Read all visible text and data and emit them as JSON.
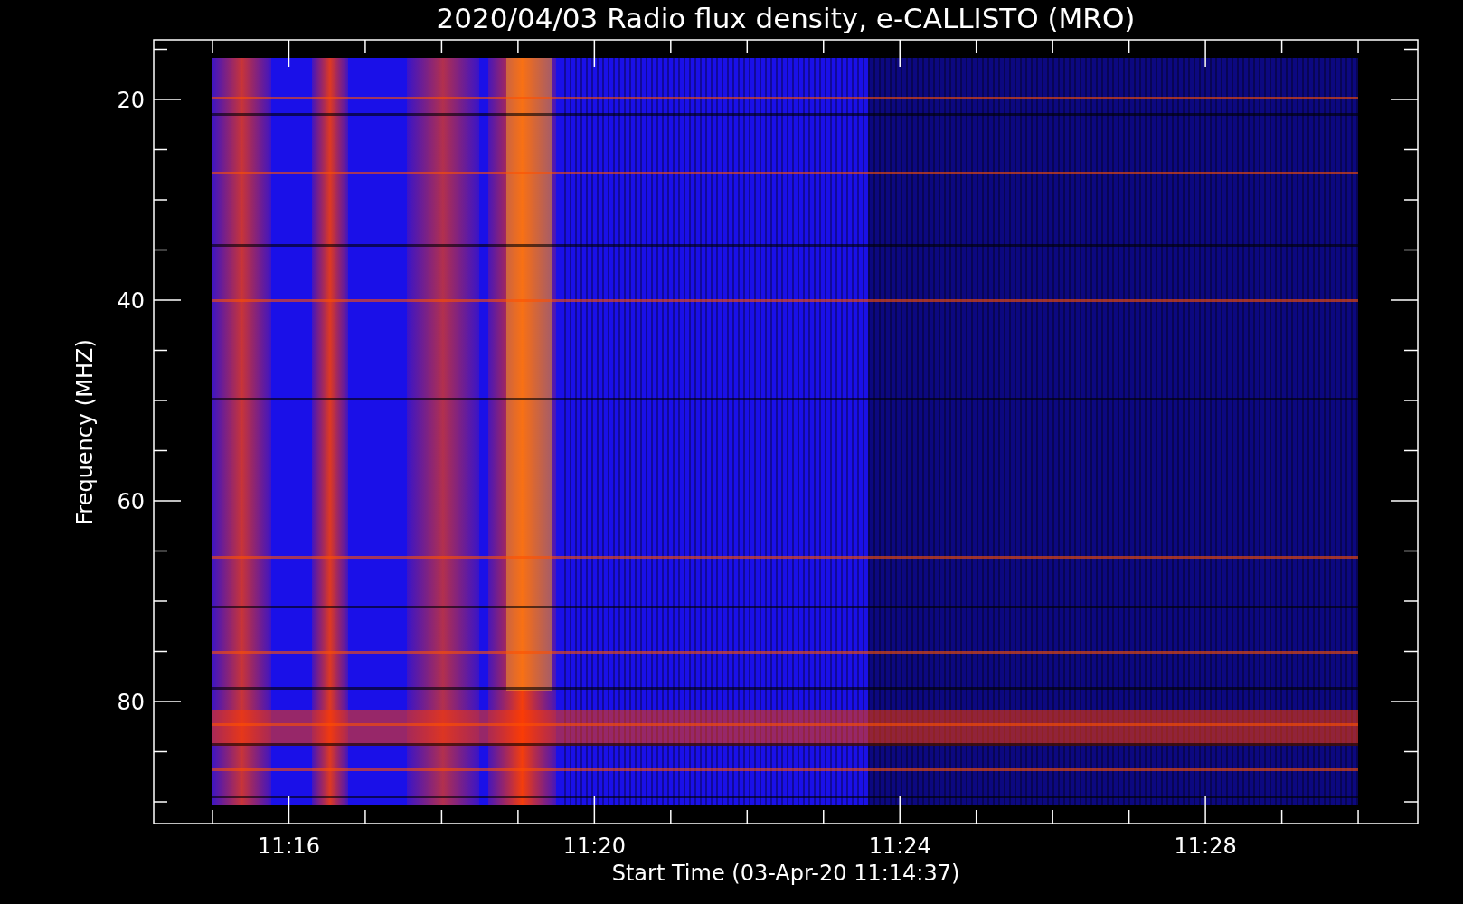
{
  "title": "2020/04/03  Radio flux density, e-CALLISTO (MRO)",
  "y_axis": {
    "label": "Frequency (MHZ)",
    "ticks": [
      "20",
      "40",
      "60",
      "80"
    ]
  },
  "x_axis": {
    "label": "Start Time (03-Apr-20 11:14:37)",
    "ticks": [
      "11:16",
      "11:20",
      "11:24",
      "11:28"
    ]
  }
}
